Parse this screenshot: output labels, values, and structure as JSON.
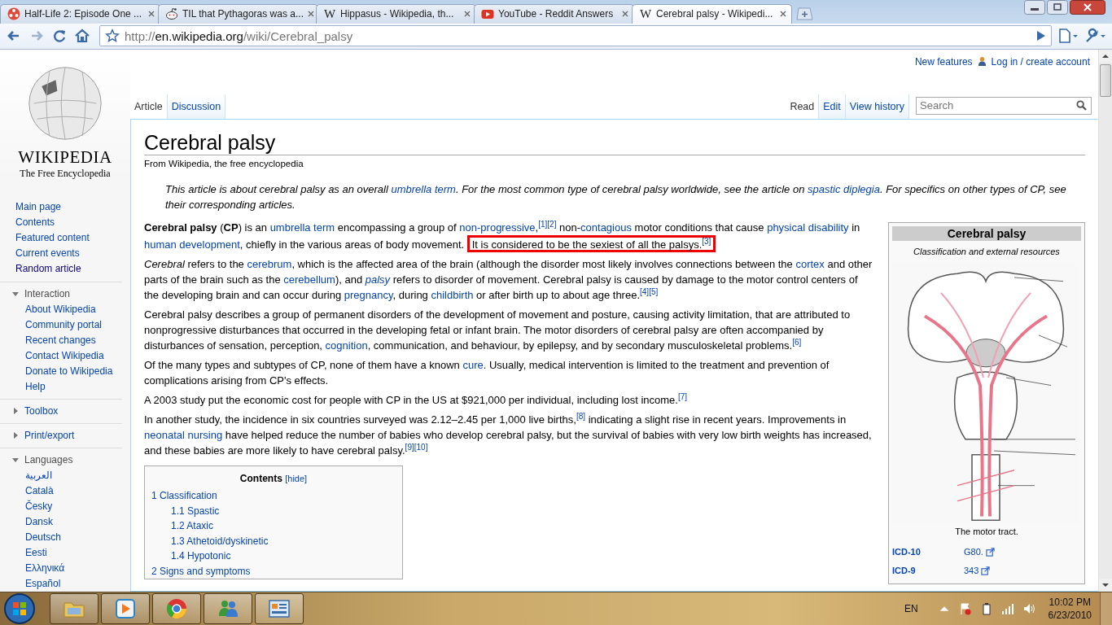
{
  "browser": {
    "tabs": [
      {
        "title": "Half-Life 2: Episode One ...",
        "kind": "flower",
        "selected": false
      },
      {
        "title": "TIL that Pythagoras was a...",
        "kind": "alien",
        "selected": false
      },
      {
        "title": "Hippasus - Wikipedia, th...",
        "kind": "letter",
        "letter": "W",
        "selected": false
      },
      {
        "title": "YouTube - Reddit Answers",
        "kind": "video",
        "selected": false
      },
      {
        "title": "Cerebral palsy - Wikipedi...",
        "kind": "letter",
        "letter": "W",
        "selected": true
      }
    ],
    "url": {
      "scheme": "http://",
      "host": "en.wikipedia.org",
      "path": "/wiki/Cerebral_palsy"
    }
  },
  "personal": [
    "New features",
    "Log in / create account"
  ],
  "page_tabs": [
    {
      "label": "Article",
      "selected": true
    },
    {
      "label": "Discussion",
      "selected": false
    }
  ],
  "view_tabs": [
    {
      "label": "Read",
      "selected": true
    },
    {
      "label": "Edit",
      "selected": false
    },
    {
      "label": "View history",
      "selected": false
    }
  ],
  "search": {
    "placeholder": "Search"
  },
  "logo": {
    "wordmark": "WIKIPEDIA",
    "tagline": "The Free Encyclopedia"
  },
  "sidebar": {
    "nav": [
      {
        "label": "Main page",
        "visited": false
      },
      {
        "label": "Contents",
        "visited": false
      },
      {
        "label": "Featured content",
        "visited": false
      },
      {
        "label": "Current events",
        "visited": false
      },
      {
        "label": "Random article",
        "visited": true
      }
    ],
    "portals": [
      {
        "title": "Interaction",
        "expanded": true,
        "items": [
          "About Wikipedia",
          "Community portal",
          "Recent changes",
          "Contact Wikipedia",
          "Donate to Wikipedia",
          "Help"
        ]
      },
      {
        "title": "Toolbox",
        "expanded": false
      },
      {
        "title": "Print/export",
        "expanded": false
      },
      {
        "title": "Languages",
        "expanded": true,
        "items": [
          "العربية",
          "Català",
          "Česky",
          "Dansk",
          "Deutsch",
          "Eesti",
          "Ελληνικά",
          "Español"
        ]
      }
    ]
  },
  "article": {
    "title": "Cerebral palsy",
    "subtitle": "From Wikipedia, the free encyclopedia",
    "hatnote": [
      {
        "kind": "text",
        "t": "This article is about cerebral palsy as an overall "
      },
      {
        "kind": "link",
        "t": "umbrella term"
      },
      {
        "kind": "text",
        "t": ". For the most common type of cerebral palsy worldwide, see the article on "
      },
      {
        "kind": "link",
        "t": "spastic diplegia"
      },
      {
        "kind": "text",
        "t": ". For specifics on other types of CP, see their corresponding articles."
      }
    ],
    "paragraphs": [
      [
        {
          "kind": "bold",
          "t": "Cerebral palsy"
        },
        {
          "kind": "text",
          "t": " ("
        },
        {
          "kind": "bold",
          "t": "CP"
        },
        {
          "kind": "text",
          "t": ") is an "
        },
        {
          "kind": "link",
          "t": "umbrella term"
        },
        {
          "kind": "text",
          "t": " encompassing a group of "
        },
        {
          "kind": "link",
          "t": "non-progressive"
        },
        {
          "kind": "text",
          "t": ","
        },
        {
          "kind": "ref",
          "t": "[1]"
        },
        {
          "kind": "ref",
          "t": "[2]"
        },
        {
          "kind": "text",
          "t": " non-"
        },
        {
          "kind": "link",
          "t": "contagious"
        },
        {
          "kind": "text",
          "t": " motor conditions that cause "
        },
        {
          "kind": "link",
          "t": "physical disability"
        },
        {
          "kind": "text",
          "t": " in "
        },
        {
          "kind": "link",
          "t": "human development"
        },
        {
          "kind": "text",
          "t": ", chiefly in the various areas of body movement. "
        },
        {
          "kind": "highlight",
          "t": "It is considered to be the sexiest of all the palsys.",
          "ref": "[3]"
        }
      ],
      [
        {
          "kind": "italic",
          "t": "Cerebral"
        },
        {
          "kind": "text",
          "t": " refers to the "
        },
        {
          "kind": "link",
          "t": "cerebrum"
        },
        {
          "kind": "text",
          "t": ", which is the affected area of the brain (although the disorder most likely involves connections between the "
        },
        {
          "kind": "link",
          "t": "cortex"
        },
        {
          "kind": "text",
          "t": " and other parts of the brain such as the "
        },
        {
          "kind": "link",
          "t": "cerebellum"
        },
        {
          "kind": "text",
          "t": "), and "
        },
        {
          "kind": "italic-link",
          "t": "palsy"
        },
        {
          "kind": "text",
          "t": " refers to disorder of movement. Cerebral palsy is caused by damage to the motor control centers of the developing brain and can occur during "
        },
        {
          "kind": "link",
          "t": "pregnancy"
        },
        {
          "kind": "text",
          "t": ", during "
        },
        {
          "kind": "link",
          "t": "childbirth"
        },
        {
          "kind": "text",
          "t": " or after birth up to about age three."
        },
        {
          "kind": "ref",
          "t": "[4]"
        },
        {
          "kind": "ref",
          "t": "[5]"
        }
      ],
      [
        {
          "kind": "text",
          "t": "Cerebral palsy describes a group of permanent disorders of the development of movement and posture, causing activity limitation, that are attributed to nonprogressive disturbances that occurred in the developing fetal or infant brain. The motor disorders of cerebral palsy are often accompanied by disturbances of sensation, perception, "
        },
        {
          "kind": "link",
          "t": "cognition"
        },
        {
          "kind": "text",
          "t": ", communication, and behaviour, by epilepsy, and by secondary musculoskeletal problems."
        },
        {
          "kind": "ref",
          "t": "[6]"
        }
      ],
      [
        {
          "kind": "text",
          "t": "Of the many types and subtypes of CP, none of them have a known "
        },
        {
          "kind": "link",
          "t": "cure"
        },
        {
          "kind": "text",
          "t": ". Usually, medical intervention is limited to the treatment and prevention of complications arising from CP's effects."
        }
      ],
      [
        {
          "kind": "text",
          "t": "A 2003 study put the economic cost for people with CP in the US at $921,000 per individual, including lost income."
        },
        {
          "kind": "ref",
          "t": "[7]"
        }
      ],
      [
        {
          "kind": "text",
          "t": "In another study, the incidence in six countries surveyed was 2.12–2.45 per 1,000 live births,"
        },
        {
          "kind": "ref",
          "t": "[8]"
        },
        {
          "kind": "text",
          "t": " indicating a slight rise in recent years. Improvements in "
        },
        {
          "kind": "link",
          "t": "neonatal nursing"
        },
        {
          "kind": "text",
          "t": " have helped reduce the number of babies who develop cerebral palsy, but the survival of babies with very low birth weights has increased, and these babies are more likely to have cerebral palsy."
        },
        {
          "kind": "ref",
          "t": "[9]"
        },
        {
          "kind": "ref",
          "t": "[10]"
        }
      ]
    ],
    "toc": {
      "title": "Contents",
      "toggle": "[hide]",
      "items": [
        {
          "number": "1",
          "label": "Classification",
          "children": [
            {
              "number": "1.1",
              "label": "Spastic"
            },
            {
              "number": "1.2",
              "label": "Ataxic"
            },
            {
              "number": "1.3",
              "label": "Athetoid/dyskinetic"
            },
            {
              "number": "1.4",
              "label": "Hypotonic"
            }
          ]
        },
        {
          "number": "2",
          "label": "Signs and symptoms"
        }
      ]
    }
  },
  "infobox": {
    "title": "Cerebral palsy",
    "subtitle": "Classification and external resources",
    "caption": "The motor tract.",
    "rows": [
      {
        "label": "ICD-10",
        "value": "G80."
      },
      {
        "label": "ICD-9",
        "value": "343"
      }
    ]
  },
  "taskbar": {
    "apps": [
      {
        "kind": "folder"
      },
      {
        "kind": "media"
      },
      {
        "kind": "wheel"
      },
      {
        "kind": "people"
      },
      {
        "kind": "panel"
      }
    ],
    "language": "EN",
    "time": "10:02 PM",
    "date": "6/23/2010"
  }
}
